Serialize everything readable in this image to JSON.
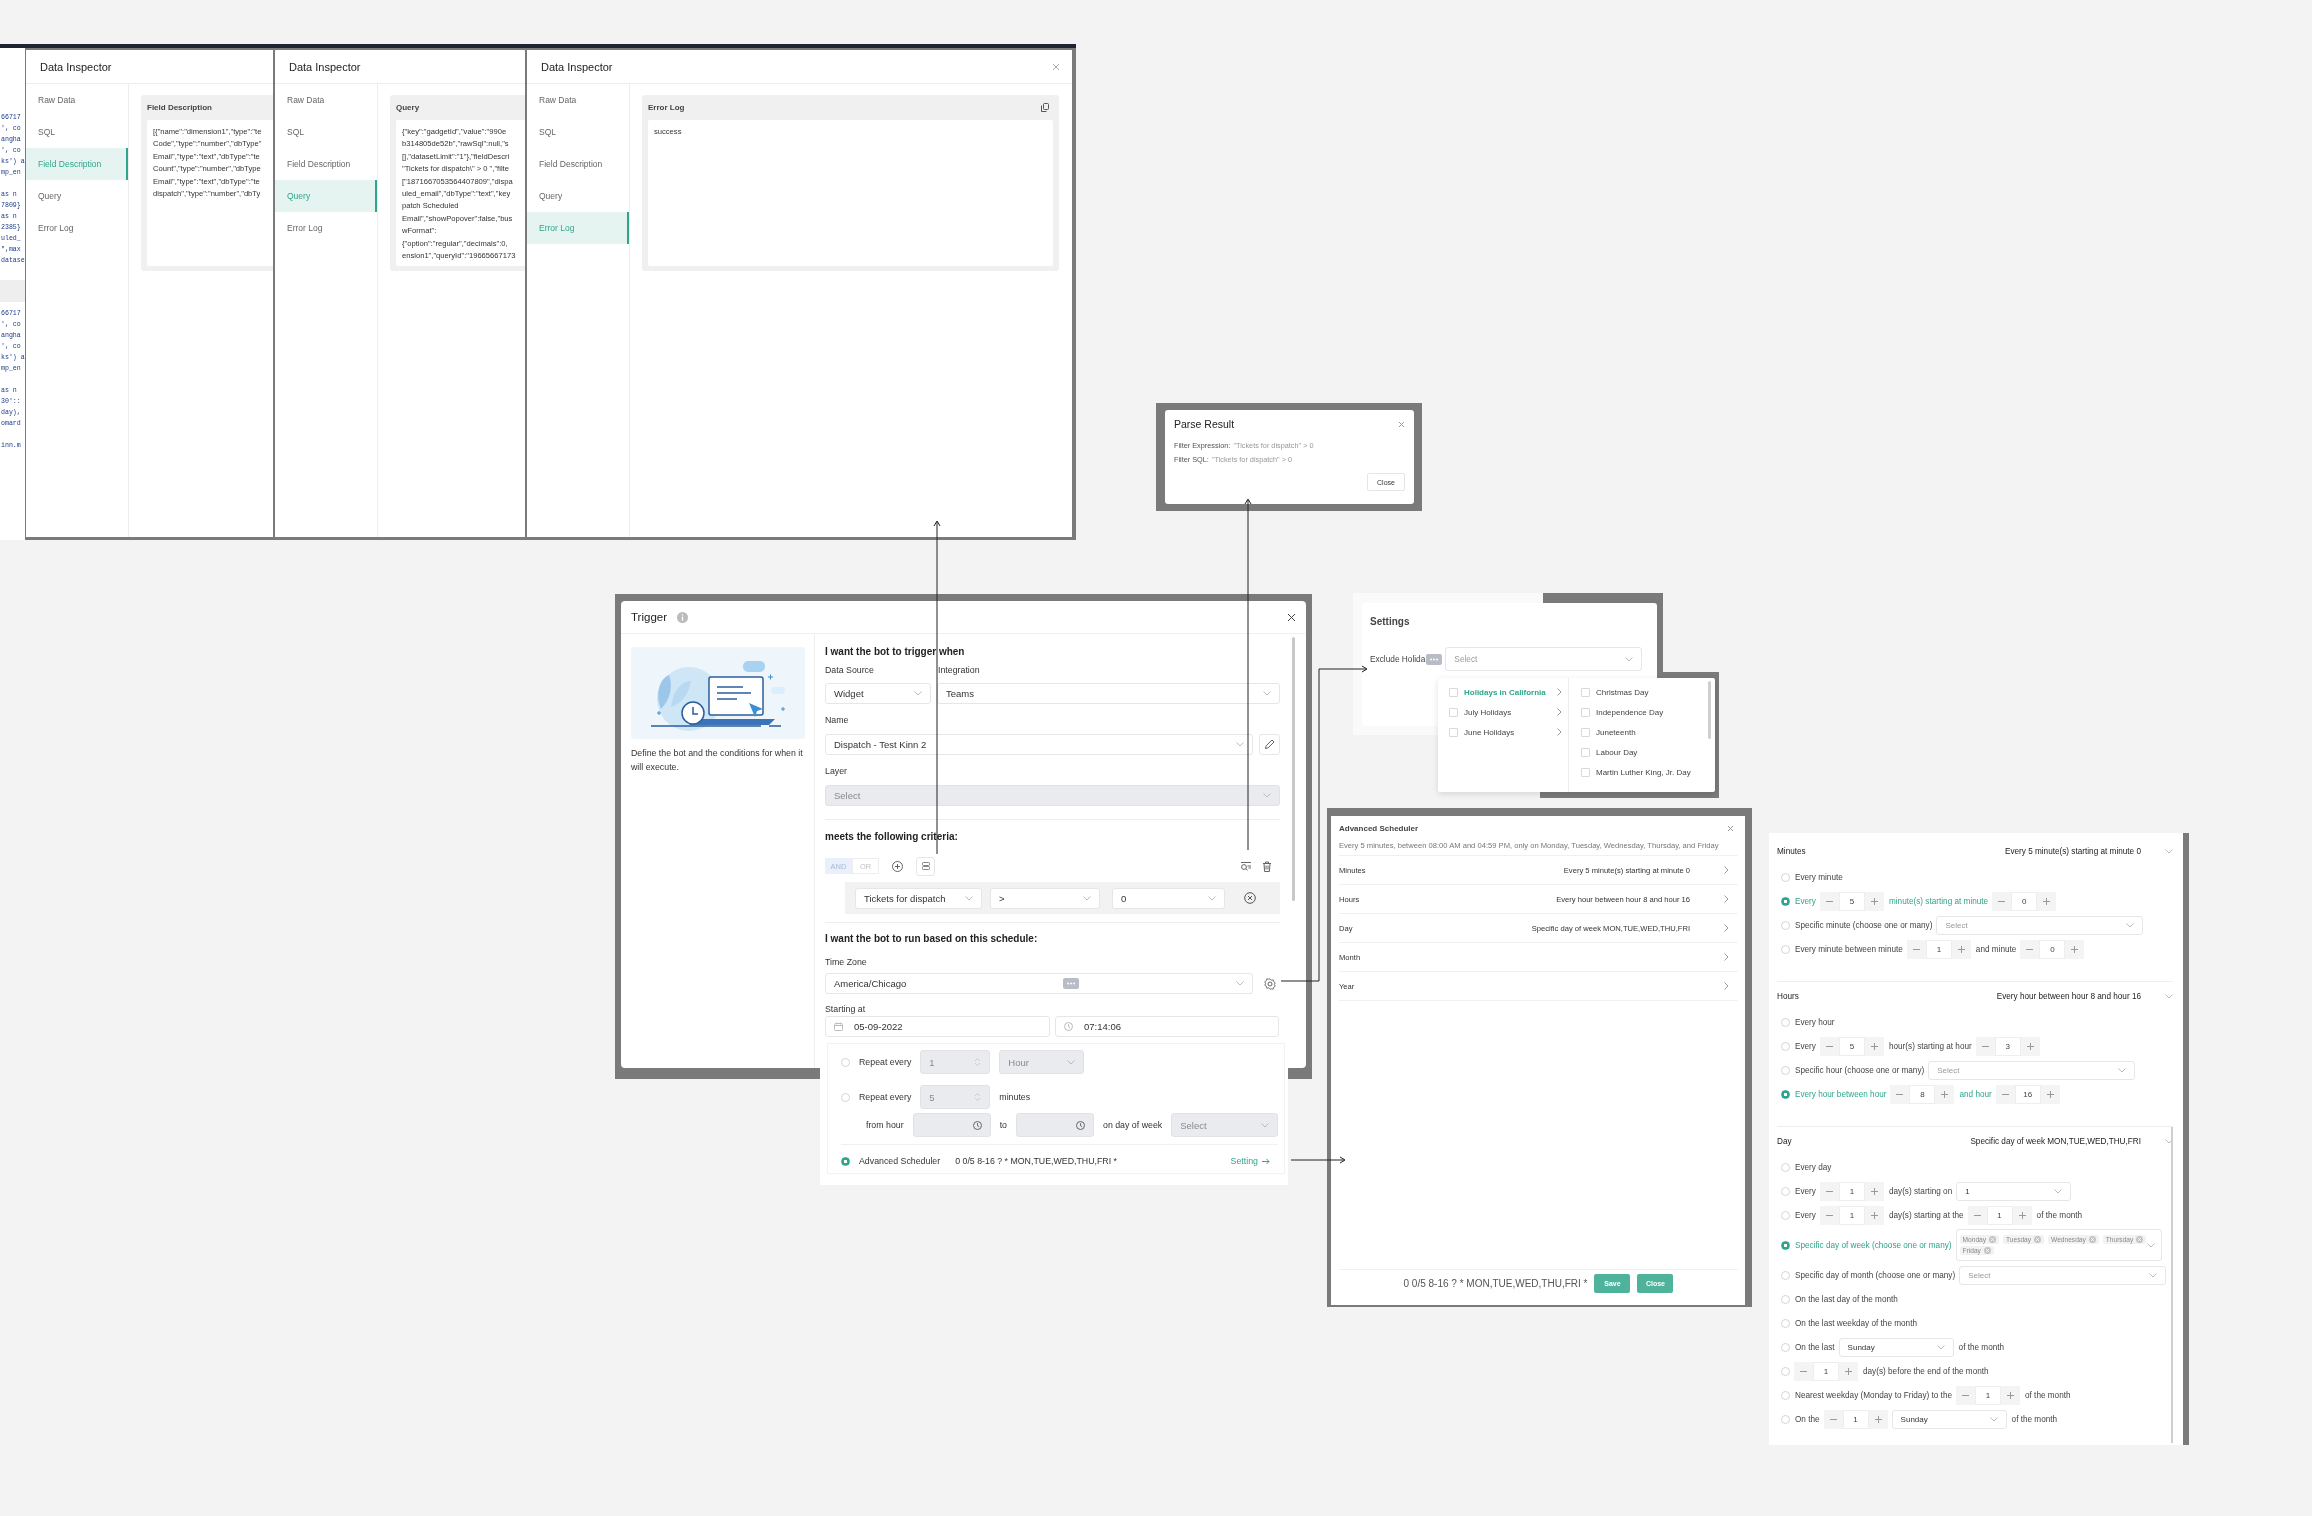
{
  "code_fragments": [
    [
      [
        "66717",
        "', co",
        "angha",
        "', co",
        "ks') a",
        "mp_en"
      ],
      [
        "as n",
        "7809}",
        "as n",
        "2385}",
        "uled_",
        "\",max",
        "datase"
      ]
    ],
    [
      [
        "66717",
        "', co",
        "angha",
        "', co",
        "ks') a",
        "mp_en"
      ],
      [
        "as n",
        "30'::",
        "day),",
        "omard"
      ],
      [
        "inn.m"
      ]
    ]
  ],
  "inspectors": [
    {
      "title": "Data Inspector",
      "closable": false,
      "tabs": [
        {
          "label": "Raw Data",
          "selected": false
        },
        {
          "label": "SQL",
          "selected": false
        },
        {
          "label": "Field Description",
          "selected": true
        },
        {
          "label": "Query",
          "selected": false
        },
        {
          "label": "Error Log",
          "selected": false
        }
      ],
      "panel": {
        "title": "Field Description",
        "copyable": false,
        "lines": [
          "[{\"name\":\"dimension1\",\"type\":\"te",
          "Code\",\"type\":\"number\",\"dbType\"",
          "Email\",\"type\":\"text\",\"dbType\":\"te",
          "Count\",\"type\":\"number\",\"dbType",
          "Email\",\"type\":\"text\",\"dbType\":\"te",
          "dispatch\",\"type\":\"number\",\"dbTy"
        ]
      }
    },
    {
      "title": "Data Inspector",
      "closable": false,
      "tabs": [
        {
          "label": "Raw Data",
          "selected": false
        },
        {
          "label": "SQL",
          "selected": false
        },
        {
          "label": "Field Description",
          "selected": false
        },
        {
          "label": "Query",
          "selected": true
        },
        {
          "label": "Error Log",
          "selected": false
        }
      ],
      "panel": {
        "title": "Query",
        "copyable": false,
        "lines": [
          "{\"key\":\"gadgetId\",\"value\":\"990e",
          "b314805de52b\",\"rawSql\":null,\"s",
          "[],\"datasetLimit\":\"1\"},\"fieldDescri",
          "\"Tickets for dispatch\\\" > 0 \",\"filte",
          "[\"1871667053564407809\",\"dispa",
          "uled_email\",\"dbType\":\"text\",\"key",
          "patch Scheduled",
          "Email\",\"showPopover\":false,\"bus",
          "wFormat\":",
          "{\"option\":\"regular\",\"decimals\":0,",
          "ension1\",\"queryId\":\"19665667173"
        ]
      }
    },
    {
      "title": "Data Inspector",
      "closable": true,
      "tabs": [
        {
          "label": "Raw Data",
          "selected": false
        },
        {
          "label": "SQL",
          "selected": false
        },
        {
          "label": "Field Description",
          "selected": false
        },
        {
          "label": "Query",
          "selected": false
        },
        {
          "label": "Error Log",
          "selected": true
        }
      ],
      "panel": {
        "title": "Error Log",
        "copyable": true,
        "lines": [
          "success"
        ]
      }
    }
  ],
  "parse_result": {
    "title": "Parse Result",
    "lines": [
      {
        "label": "Filter Expression:",
        "value": "\"Tickets for dispatch\" > 0"
      },
      {
        "label": "Filter SQL:",
        "value": "\"Tickets for dispatch\" > 0"
      }
    ],
    "button": "Close"
  },
  "settings": {
    "title": "Settings",
    "field": {
      "label": "Exclude Holida",
      "placeholder": "Select"
    },
    "groups": [
      {
        "label": "Holidays in California",
        "selected": true,
        "checked": false
      },
      {
        "label": "July Holidays",
        "selected": false,
        "checked": false
      },
      {
        "label": "June Holidays",
        "selected": false,
        "checked": false
      }
    ],
    "options": [
      {
        "label": "Christmas Day",
        "checked": false
      },
      {
        "label": "Independence Day",
        "checked": false
      },
      {
        "label": "Juneteenth",
        "checked": false
      },
      {
        "label": "Labour Day",
        "checked": false
      },
      {
        "label": "Martin Luther King, Jr. Day",
        "checked": false
      }
    ]
  },
  "trigger": {
    "title": "Trigger",
    "description": "Define the bot and the conditions for when it will execute.",
    "heading_trigger": "I want the bot to trigger when",
    "data_source": {
      "label": "Data Source",
      "value": "Widget"
    },
    "integration": {
      "label": "Integration",
      "value": "Teams"
    },
    "name": {
      "label": "Name",
      "value": "Dispatch - Test Kinn 2"
    },
    "layer": {
      "label": "Layer",
      "placeholder": "Select",
      "disabled": true
    },
    "heading_criteria": "meets the following criteria:",
    "logic": [
      {
        "label": "AND",
        "selected": true
      },
      {
        "label": "OR",
        "selected": false
      }
    ],
    "condition": {
      "field": "Tickets for dispatch",
      "operator": ">",
      "value": "0"
    },
    "heading_schedule": "I want the bot to run based on this schedule:",
    "time_zone": {
      "label": "Time Zone",
      "value": "America/Chicago"
    },
    "starting_at": {
      "label": "Starting at",
      "date": "05-09-2022",
      "time": "07:14:06"
    },
    "schedule_rows": [
      {
        "kind": "radio",
        "selected": false,
        "parts": [
          {
            "kind": "text",
            "text": "Repeat every"
          },
          {
            "kind": "spin",
            "value": "1",
            "disabled": true
          },
          {
            "kind": "select",
            "value": "Hour",
            "disabled": true
          }
        ]
      },
      {
        "kind": "radio",
        "selected": false,
        "parts": [
          {
            "kind": "text",
            "text": "Repeat every"
          },
          {
            "kind": "spin",
            "value": "5",
            "disabled": true
          },
          {
            "kind": "text",
            "text": "minutes"
          }
        ]
      },
      {
        "kind": "indent",
        "parts": [
          {
            "kind": "text",
            "text": "from hour"
          },
          {
            "kind": "time",
            "disabled": true
          },
          {
            "kind": "text",
            "text": "to"
          },
          {
            "kind": "time",
            "disabled": true
          },
          {
            "kind": "text",
            "text": "on day of week"
          },
          {
            "kind": "select",
            "placeholder": "Select",
            "disabled": true
          }
        ]
      },
      {
        "kind": "radio",
        "selected": true,
        "parts": [
          {
            "kind": "text",
            "text": "Advanced Scheduler"
          },
          {
            "kind": "code",
            "text": "0 0/5 8-16 ? * MON,TUE,WED,THU,FRI *"
          },
          {
            "kind": "link",
            "text": "Setting"
          }
        ]
      }
    ]
  },
  "advanced_scheduler": {
    "title": "Advanced Scheduler",
    "description": "Every 5 minutes, between 08:00 AM and 04:59 PM, only on Monday, Tuesday, Wednesday, Thursday, and Friday",
    "rows": [
      {
        "label": "Minutes",
        "summary": "Every 5 minute(s) starting at minute 0"
      },
      {
        "label": "Hours",
        "summary": "Every hour between hour 8 and hour 16"
      },
      {
        "label": "Day",
        "summary": "Specific day of week MON,TUE,WED,THU,FRI"
      },
      {
        "label": "Month"
      },
      {
        "label": "Year"
      }
    ],
    "expression": "0 0/5 8-16 ? * MON,TUE,WED,THU,FRI *",
    "buttons": [
      "Save",
      "Close"
    ]
  },
  "scheduler_detail": {
    "sections": [
      {
        "title": "Minutes",
        "summary": "Every 5 minute(s) starting at minute 0",
        "rows": [
          {
            "selected": false,
            "parts": [
              {
                "kind": "text",
                "text": "Every minute"
              }
            ]
          },
          {
            "selected": true,
            "parts": [
              {
                "kind": "text",
                "text": "Every"
              },
              {
                "kind": "stepper",
                "value": "5"
              },
              {
                "kind": "text",
                "text": "minute(s) starting at minute"
              },
              {
                "kind": "stepper",
                "value": "0"
              }
            ]
          },
          {
            "selected": false,
            "parts": [
              {
                "kind": "text",
                "text": "Specific minute (choose one or many)"
              },
              {
                "kind": "select",
                "placeholder": "Select"
              }
            ]
          },
          {
            "selected": false,
            "parts": [
              {
                "kind": "text",
                "text": "Every minute between minute"
              },
              {
                "kind": "stepper",
                "value": "1"
              },
              {
                "kind": "text",
                "text": "and minute"
              },
              {
                "kind": "stepper",
                "value": "0"
              }
            ]
          }
        ]
      },
      {
        "title": "Hours",
        "summary": "Every hour between hour 8 and hour 16",
        "rows": [
          {
            "selected": false,
            "parts": [
              {
                "kind": "text",
                "text": "Every hour"
              }
            ]
          },
          {
            "selected": false,
            "parts": [
              {
                "kind": "text",
                "text": "Every"
              },
              {
                "kind": "stepper",
                "value": "5"
              },
              {
                "kind": "text",
                "text": "hour(s) starting at hour"
              },
              {
                "kind": "stepper",
                "value": "3"
              }
            ]
          },
          {
            "selected": false,
            "parts": [
              {
                "kind": "text",
                "text": "Specific hour (choose one or many)"
              },
              {
                "kind": "select",
                "placeholder": "Select"
              }
            ]
          },
          {
            "selected": true,
            "parts": [
              {
                "kind": "text",
                "text": "Every hour between hour"
              },
              {
                "kind": "stepper",
                "value": "8"
              },
              {
                "kind": "text",
                "text": "and hour"
              },
              {
                "kind": "stepper",
                "value": "16"
              }
            ]
          }
        ]
      },
      {
        "title": "Day",
        "summary": "Specific day of week MON,TUE,WED,THU,FRI",
        "rows": [
          {
            "selected": false,
            "parts": [
              {
                "kind": "text",
                "text": "Every day"
              }
            ]
          },
          {
            "selected": false,
            "parts": [
              {
                "kind": "text",
                "text": "Every"
              },
              {
                "kind": "stepper",
                "value": "1"
              },
              {
                "kind": "text",
                "text": "day(s) starting on"
              },
              {
                "kind": "select",
                "value": "1"
              }
            ]
          },
          {
            "selected": false,
            "parts": [
              {
                "kind": "text",
                "text": "Every"
              },
              {
                "kind": "stepper",
                "value": "1"
              },
              {
                "kind": "text",
                "text": "day(s) starting at the"
              },
              {
                "kind": "stepper",
                "value": "1"
              },
              {
                "kind": "text",
                "text": "of the month"
              }
            ]
          },
          {
            "selected": true,
            "parts": [
              {
                "kind": "text",
                "text": "Specific day of week (choose one or many)"
              },
              {
                "kind": "tags",
                "tags": [
                  "Monday",
                  "Tuesday",
                  "Wednesday",
                  "Thursday",
                  "Friday"
                ]
              }
            ]
          },
          {
            "selected": false,
            "parts": [
              {
                "kind": "text",
                "text": "Specific day of month (choose one or many)"
              },
              {
                "kind": "select",
                "placeholder": "Select"
              }
            ]
          },
          {
            "selected": false,
            "parts": [
              {
                "kind": "text",
                "text": "On the last day of the month"
              }
            ]
          },
          {
            "selected": false,
            "parts": [
              {
                "kind": "text",
                "text": "On the last weekday of the month"
              }
            ]
          },
          {
            "selected": false,
            "parts": [
              {
                "kind": "text",
                "text": "On the last"
              },
              {
                "kind": "select",
                "value": "Sunday"
              },
              {
                "kind": "text",
                "text": "of the month"
              }
            ]
          },
          {
            "selected": false,
            "parts": [
              {
                "kind": "stepper",
                "value": "1"
              },
              {
                "kind": "text",
                "text": "day(s) before the end of the month"
              }
            ]
          },
          {
            "selected": false,
            "parts": [
              {
                "kind": "text",
                "text": "Nearest weekday (Monday to Friday) to the"
              },
              {
                "kind": "stepper",
                "value": "1"
              },
              {
                "kind": "text",
                "text": "of the month"
              }
            ]
          },
          {
            "selected": false,
            "parts": [
              {
                "kind": "text",
                "text": "On the"
              },
              {
                "kind": "stepper",
                "value": "1"
              },
              {
                "kind": "select",
                "value": "Sunday"
              },
              {
                "kind": "text",
                "text": "of the month"
              }
            ]
          }
        ]
      }
    ]
  }
}
